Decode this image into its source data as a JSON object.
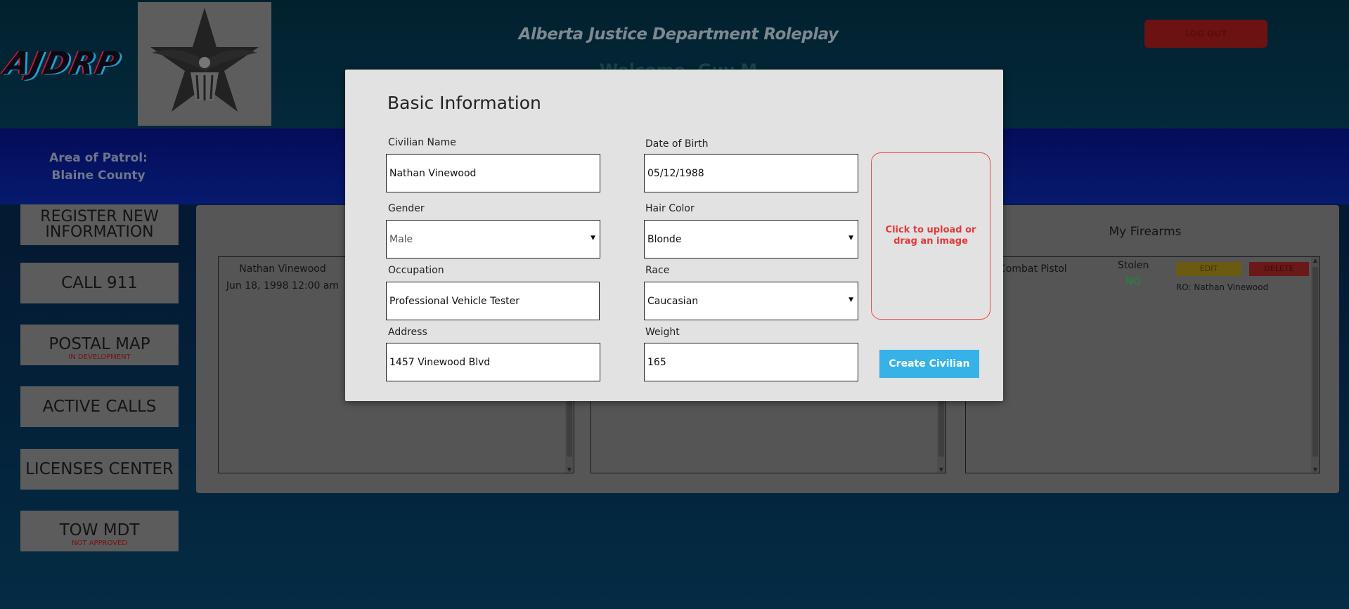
{
  "header": {
    "brand": "AJDRP",
    "title": "Alberta Justice Department Roleplay",
    "welcome": "Welcome, Guy M",
    "logout_label": "LOG OUT"
  },
  "patrol": {
    "label": "Area of Patrol:",
    "value": "Blaine County"
  },
  "sidebar": {
    "items": [
      {
        "label": "REGISTER NEW INFORMATION",
        "sub": ""
      },
      {
        "label": "CALL 911",
        "sub": ""
      },
      {
        "label": "POSTAL MAP",
        "sub": "IN DEVELOPMENT"
      },
      {
        "label": "ACTIVE CALLS",
        "sub": ""
      },
      {
        "label": "LICENSES CENTER",
        "sub": ""
      },
      {
        "label": "TOW MDT",
        "sub": "NOT APPROVED"
      }
    ]
  },
  "civilians": {
    "name": "Nathan Vinewood",
    "date": "Jun 18, 1998 12:00 am"
  },
  "firearms": {
    "title": "My Firearms",
    "weapon": "Combat Pistol",
    "stolen_label": "Stolen",
    "stolen_value": "NO",
    "edit_label": "EDIT",
    "delete_label": "DELETE",
    "ro": "RO: Nathan Vinewood"
  },
  "modal": {
    "title": "Basic Information",
    "fields": {
      "civilian_name": {
        "label": "Civilian Name",
        "value": "Nathan Vinewood"
      },
      "dob": {
        "label": "Date of Birth",
        "value": "05/12/1988"
      },
      "gender": {
        "label": "Gender",
        "value": "Male"
      },
      "hair": {
        "label": "Hair Color",
        "value": "Blonde"
      },
      "occupation": {
        "label": "Occupation",
        "value": "Professional Vehicle Tester"
      },
      "race": {
        "label": "Race",
        "value": "Caucasian"
      },
      "address": {
        "label": "Address",
        "value": "1457 Vinewood Blvd"
      },
      "weight": {
        "label": "Weight",
        "value": "165"
      }
    },
    "upload_text": "Click to upload or drag an image",
    "create_label": "Create Civilian"
  },
  "colors": {
    "create_button": "#36b2e6",
    "upload_border": "#e64b4b",
    "logout": "#6c1212",
    "stolen_no": "#1f8a3a"
  }
}
